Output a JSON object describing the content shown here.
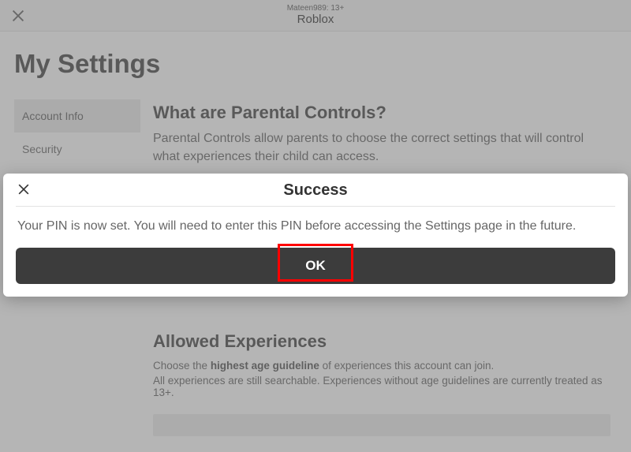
{
  "header": {
    "user_label": "Mateen989: 13+",
    "app_title": "Roblox"
  },
  "page": {
    "title": "My Settings"
  },
  "sidebar": {
    "items": [
      {
        "label": "Account Info"
      },
      {
        "label": "Security"
      }
    ]
  },
  "parental": {
    "heading": "What are Parental Controls?",
    "text": "Parental Controls allow parents to choose the correct settings that will control what experiences their child can access."
  },
  "allowed": {
    "heading": "Allowed Experiences",
    "choose_prefix": "Choose the ",
    "choose_bold": "highest age guideline",
    "choose_suffix": " of experiences this account can join.",
    "all_text": "All experiences are still searchable. Experiences without age guidelines are currently treated as 13+."
  },
  "modal": {
    "title": "Success",
    "body": "Your PIN is now set. You will need to enter this PIN before accessing the Settings page in the future.",
    "ok_label": "OK"
  }
}
